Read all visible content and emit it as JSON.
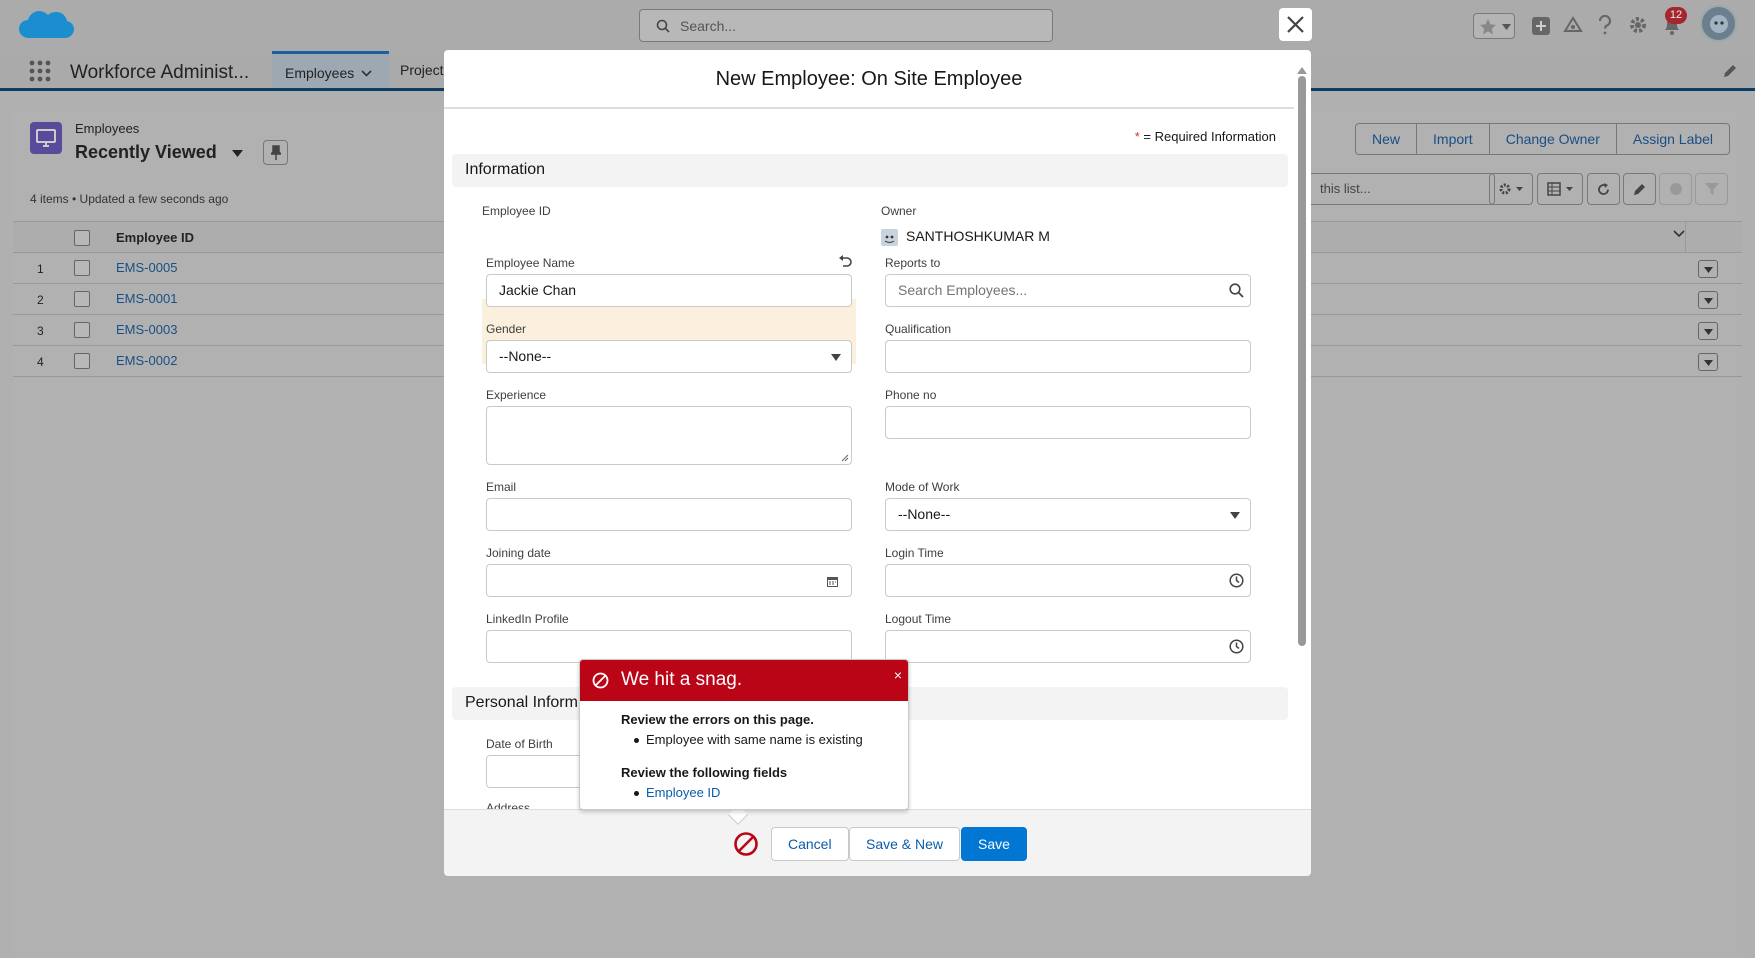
{
  "global_header": {
    "search_placeholder": "Search...",
    "notification_count": "12"
  },
  "nav": {
    "app_name": "Workforce Administ...",
    "tabs": [
      "Employees",
      "Projects"
    ]
  },
  "list_view": {
    "object_label": "Employees",
    "title": "Recently Viewed",
    "meta": "4 items • Updated a few seconds ago",
    "actions": [
      "New",
      "Import",
      "Change Owner",
      "Assign Label"
    ],
    "search_placeholder": "this list...",
    "column_header": "Employee ID",
    "rows": [
      {
        "num": "1",
        "id": "EMS-0005"
      },
      {
        "num": "2",
        "id": "EMS-0001"
      },
      {
        "num": "3",
        "id": "EMS-0003"
      },
      {
        "num": "4",
        "id": "EMS-0002"
      }
    ]
  },
  "modal": {
    "title": "New Employee: On Site Employee",
    "required_star": "*",
    "required_text": "= Required Information",
    "section_info": "Information",
    "section_personal": "Personal Inform",
    "fields": {
      "employee_id": {
        "label": "Employee ID"
      },
      "owner": {
        "label": "Owner",
        "value": "SANTHOSHKUMAR M"
      },
      "employee_name": {
        "label": "Employee Name",
        "value": "Jackie Chan"
      },
      "reports_to": {
        "label": "Reports to",
        "placeholder": "Search Employees..."
      },
      "gender": {
        "label": "Gender",
        "value": "--None--"
      },
      "qualification": {
        "label": "Qualification",
        "value": ""
      },
      "experience": {
        "label": "Experience",
        "value": ""
      },
      "phone": {
        "label": "Phone no",
        "value": ""
      },
      "email": {
        "label": "Email",
        "value": ""
      },
      "mode_of_work": {
        "label": "Mode of Work",
        "value": "--None--"
      },
      "joining_date": {
        "label": "Joining date",
        "value": ""
      },
      "login_time": {
        "label": "Login Time",
        "value": ""
      },
      "linkedin": {
        "label": "LinkedIn Profile",
        "value": ""
      },
      "logout_time": {
        "label": "Logout Time",
        "value": ""
      },
      "dob": {
        "label": "Date of Birth",
        "value": ""
      },
      "address": {
        "label": "Address"
      }
    },
    "footer": {
      "cancel": "Cancel",
      "save_new": "Save & New",
      "save": "Save"
    }
  },
  "error_popover": {
    "title": "We hit a snag.",
    "close": "×",
    "errors_heading": "Review the errors on this page.",
    "errors": [
      "Employee with same name is existing"
    ],
    "fields_heading": "Review the following fields",
    "fields": [
      "Employee ID"
    ]
  },
  "colors": {
    "brand": "#0176d3",
    "error": "#ba0517",
    "link": "#0b5cab"
  }
}
